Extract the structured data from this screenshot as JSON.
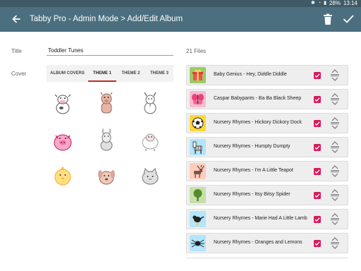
{
  "status_bar": {
    "battery": "28%",
    "time": "13:14"
  },
  "app_bar": {
    "title": "Tabby Pro - Admin Mode > Add/Edit Album"
  },
  "form": {
    "title_label": "Title",
    "title_value": "Toddler Tunes",
    "cover_label": "Cover"
  },
  "tabs": [
    {
      "label": "ALBUM COVERS"
    },
    {
      "label": "THEME 1"
    },
    {
      "label": "THEME 2"
    },
    {
      "label": "THEME 3"
    }
  ],
  "covers": [
    "cow",
    "pig-standing",
    "goat",
    "pig",
    "donkey",
    "sheep",
    "chick",
    "dog",
    "cat"
  ],
  "files": {
    "count_label": "21 Files",
    "items": [
      {
        "name": "Baby Genius - Hey, Diddle Diddle",
        "icon": "gift-icon",
        "checked": true
      },
      {
        "name": "Caspar Babypants - Ba Ba Black Sheep",
        "icon": "butterfly-icon",
        "checked": true
      },
      {
        "name": "Nursery Rhymes - Hickory Dickory Dock",
        "icon": "soccer-ball-icon",
        "checked": true
      },
      {
        "name": "Nursery Rhymes - Humpty Dumpty",
        "icon": "zebra-icon",
        "checked": true
      },
      {
        "name": "Nursery Rhymes - I'm A Little Teapot",
        "icon": "moose-icon",
        "checked": true
      },
      {
        "name": "Nursery Rhymes - Itsy Bitsy Spider",
        "icon": "tree-icon",
        "checked": true
      },
      {
        "name": "Nursery Rhymes - Marie Had A Little Lamb",
        "icon": "bird-icon",
        "checked": true
      },
      {
        "name": "Nursery Rhymes - Oranges and Lemons",
        "icon": "spider-icon",
        "checked": true
      }
    ]
  },
  "colors": {
    "status_bar": "#3f5a66",
    "app_bar": "#4b6f7f",
    "accent": "#d81b60",
    "tab_indicator": "#c62828"
  }
}
